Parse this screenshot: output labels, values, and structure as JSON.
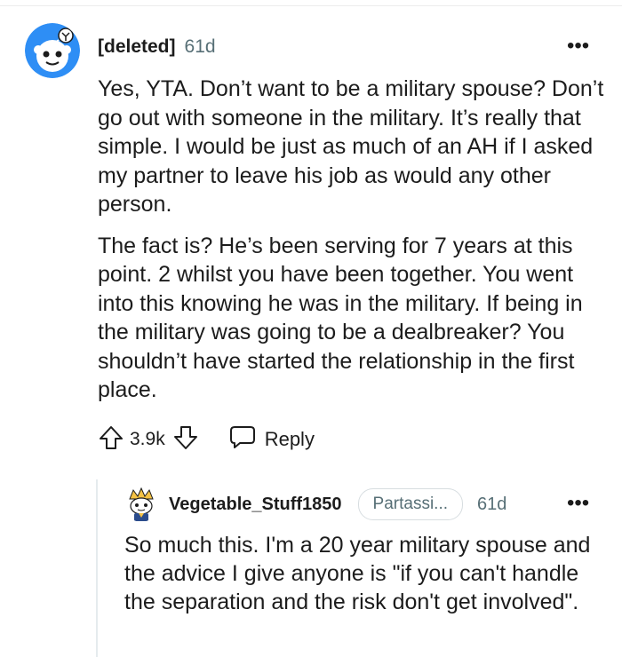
{
  "main_comment": {
    "username": "[deleted]",
    "time": "61d",
    "more_label": "•••",
    "paragraphs": [
      "Yes, YTA. Don’t want to be a military spouse? Don’t go out with someone in the military. It’s really that simple. I would be just as much of an AH if I asked my partner to leave his job as would any other person.",
      "The fact is? He’s been serving for 7 years at this point. 2 whilst you have been together. You went into this knowing he was in the military. If being in the military was going to be a dealbreaker? You shouldn’t have started the relationship in the first place."
    ],
    "votes": "3.9k",
    "reply_label": "Reply"
  },
  "reply_comment": {
    "username": "Vegetable_Stuff1850",
    "flair": "Partassi...",
    "time": "61d",
    "more_label": "•••",
    "text": "So much this. I'm a 20 year military spouse and the advice I give anyone is \"if you can't handle the separation and the risk don't get involved\"."
  },
  "colors": {
    "text": "#1c1c1c",
    "meta": "#576f76",
    "avatar_blue": "#2e8ef5",
    "thread_line": "#e5ebee"
  },
  "icons": {
    "upvote": "arrow-up-outline-icon",
    "downvote": "arrow-down-outline-icon",
    "reply": "speech-bubble-icon",
    "more": "overflow-dots-icon"
  }
}
